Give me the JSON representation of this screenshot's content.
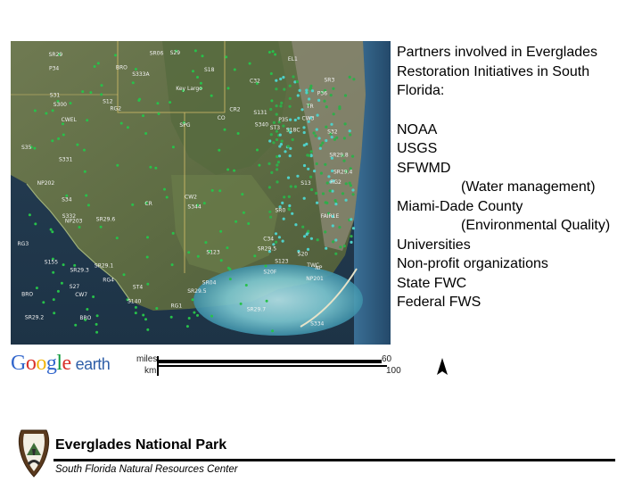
{
  "map": {
    "left_labels": [
      "CR2",
      "SR29.8",
      "SR29.7",
      "SR29.5",
      "SR29.6",
      "SR29.4",
      "FAIR1E",
      "EL1",
      "SR29.2",
      "SR29.1",
      "SR29",
      "SR29.3",
      "SR29.5",
      "S140",
      "S340",
      "S123",
      "S334",
      "S155",
      "S131",
      "S332",
      "S344",
      "S13",
      "S333A",
      "SR06",
      "SR04",
      "NP201",
      "NP202",
      "NP203",
      "P34",
      "P35",
      "P36",
      "RG2",
      "RG3",
      "RG4",
      "SR0",
      "SR3",
      "RG1",
      "RG2",
      "BRO",
      "TWC",
      "CWEL",
      "SPG",
      "S20",
      "CO",
      "C34",
      "C32",
      "S20F",
      "S331",
      "ST3",
      "TR",
      "NP",
      "CR",
      "ST4",
      "Key Largo",
      "CW3",
      "S29",
      "S27",
      "S123",
      "S18",
      "S12",
      "S18C",
      "S35",
      "S34",
      "S32",
      "S31",
      "S300",
      "BRO",
      "CW7",
      "CW2",
      "BRO"
    ]
  },
  "partners": {
    "title": "Partners involved in Everglades Restoration Initiatives in South Florida:",
    "items": [
      {
        "text": "NOAA",
        "sub": false
      },
      {
        "text": "USGS",
        "sub": false
      },
      {
        "text": "SFWMD",
        "sub": false
      },
      {
        "text": "(Water management)",
        "sub": true
      },
      {
        "text": "Miami-Dade County",
        "sub": false
      },
      {
        "text": "(Environmental Quality)",
        "sub": true
      },
      {
        "text": "Universities",
        "sub": false
      },
      {
        "text": "Non-profit organizations",
        "sub": false
      },
      {
        "text": "State FWC",
        "sub": false
      },
      {
        "text": "Federal FWS",
        "sub": false
      }
    ]
  },
  "google_earth": {
    "logo_letters": [
      "G",
      "o",
      "o",
      "g",
      "l",
      "e"
    ],
    "logo_colors": [
      "#3266cc",
      "#d9322a",
      "#f2b50f",
      "#3266cc",
      "#129a3e",
      "#d9322a"
    ],
    "earth_word": "earth"
  },
  "scale": {
    "miles_label": "miles",
    "km_label": "km",
    "miles_value": "60",
    "km_value": "100"
  },
  "footer": {
    "park_name": "Everglades National Park",
    "center_name": "South Florida Natural Resources Center",
    "logo_text": "NATIONAL PARK SERVICE"
  }
}
